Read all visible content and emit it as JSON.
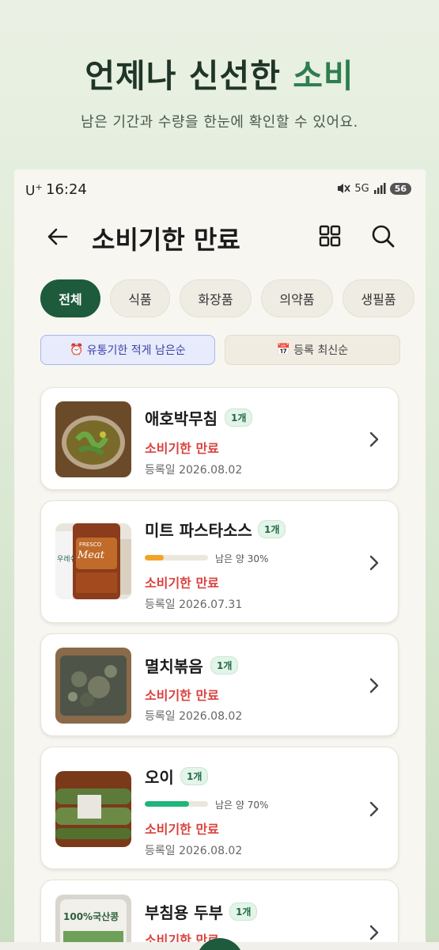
{
  "promo": {
    "title_main": "언제나 신선한 ",
    "title_accent": "소비",
    "subtitle": "남은 기간과 수량을 한눈에 확인할 수 있어요."
  },
  "status_bar": {
    "carrier": "U",
    "carrier_sup": "+",
    "time": "16:24",
    "network": "5G",
    "battery": "56"
  },
  "header": {
    "title": "소비기한 만료"
  },
  "tabs": [
    {
      "label": "전체",
      "active": true
    },
    {
      "label": "식품"
    },
    {
      "label": "화장품"
    },
    {
      "label": "의약품"
    },
    {
      "label": "생필품"
    }
  ],
  "sorts": {
    "primary": {
      "icon": "⏰",
      "label": "유통기한 적게 남은순"
    },
    "secondary": {
      "icon": "📅",
      "label": "등록 최신순"
    }
  },
  "items": [
    {
      "name": "애호박무침",
      "qty": "1개",
      "status": "소비기한 만료",
      "registered": "등록일 2026.08.02"
    },
    {
      "name": "미트 파스타소스",
      "qty": "1개",
      "remaining_label": "남은 양 30%",
      "remaining": 0.3,
      "bar_color": "#f0a52a",
      "status": "소비기한 만료",
      "registered": "등록일 2026.07.31"
    },
    {
      "name": "멸치볶음",
      "qty": "1개",
      "status": "소비기한 만료",
      "registered": "등록일 2026.08.02"
    },
    {
      "name": "오이",
      "qty": "1개",
      "remaining_label": "남은 양 70%",
      "remaining": 0.7,
      "bar_color": "#1fb57a",
      "status": "소비기한 만료",
      "registered": "등록일 2026.08.02"
    },
    {
      "name": "부침용 두부",
      "qty": "1개",
      "status": "소비기한 만료"
    }
  ],
  "thumb_text": {
    "sauce_brand": "FRESCO",
    "sauce_label": "Meat",
    "sauce_side": "우레쉬",
    "tofu_label": "100%국산콩"
  }
}
